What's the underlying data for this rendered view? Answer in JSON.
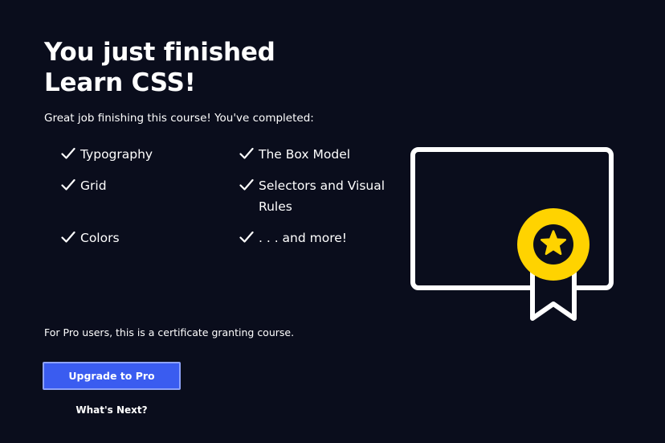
{
  "heading": {
    "line1": "You just finished",
    "line2": "Learn CSS!"
  },
  "intro": "Great job finishing this course! You've completed:",
  "topics": [
    "Typography",
    "The Box Model",
    "Grid",
    "Selectors and Visual",
    "Rules",
    "Colors",
    ". . . and more!"
  ],
  "pro_note": "For Pro users, this is a certificate granting course.",
  "upgrade_label": "Upgrade to Pro",
  "next_label": "What's Next?",
  "icons": {
    "check": "check-icon",
    "certificate": "certificate-icon",
    "badge": "star-badge-icon"
  },
  "colors": {
    "background": "#0a0d1c",
    "text": "#ffffff",
    "button": "#3a5cf0",
    "button_border": "#8ea2f8",
    "badge": "#ffd300"
  }
}
